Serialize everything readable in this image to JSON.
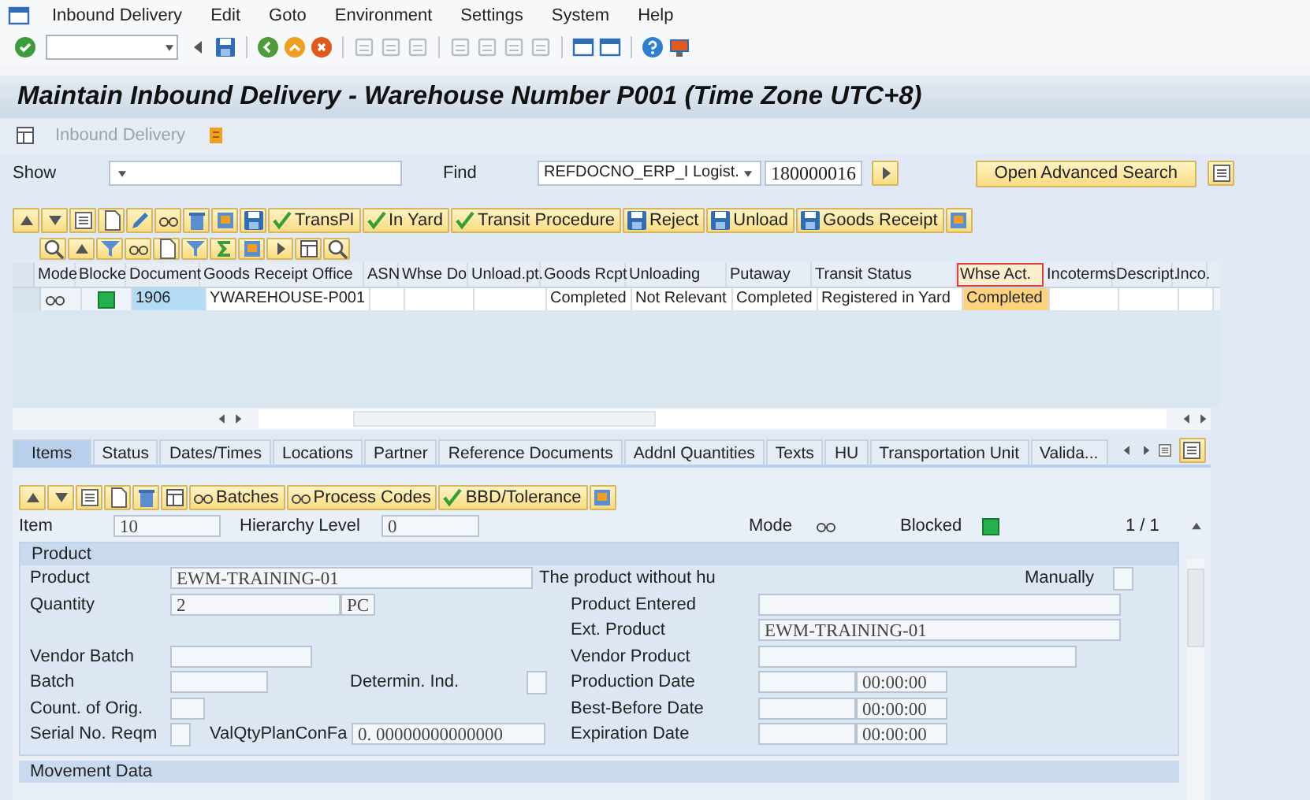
{
  "menu_bar": [
    "Inbound Delivery",
    "Edit",
    "Goto",
    "Environment",
    "Settings",
    "System",
    "Help"
  ],
  "title": "Maintain Inbound Delivery - Warehouse Number P001 (Time Zone UTC+8)",
  "app_toolbar": {
    "label": "Inbound Delivery",
    "disabled": true
  },
  "search": {
    "show_label": "Show",
    "find_label": "Find",
    "find_field": "REFDOCNO_ERP_I Logist.",
    "find_value": "180000016",
    "advanced_button": "Open Advanced Search"
  },
  "list_toolbar": [
    "TransPl",
    "In Yard",
    "Transit Procedure",
    "Reject",
    "Unload",
    "Goods Receipt"
  ],
  "table": {
    "columns": [
      {
        "label": "Mode",
        "kind": "icon",
        "selected": false
      },
      {
        "label": "Blocke",
        "kind": "status",
        "selected": false
      },
      {
        "label": "Document",
        "kind": "key",
        "selected": false
      },
      {
        "label": "Goods Receipt Office",
        "kind": "text",
        "selected": false
      },
      {
        "label": "ASN",
        "kind": "text",
        "selected": false
      },
      {
        "label": "Whse Do",
        "kind": "text",
        "selected": false
      },
      {
        "label": "Unload.pt.",
        "kind": "text",
        "selected": false
      },
      {
        "label": "Goods Rcpt",
        "kind": "text",
        "selected": false
      },
      {
        "label": "Unloading",
        "kind": "text",
        "selected": false
      },
      {
        "label": "Putaway",
        "kind": "text",
        "selected": false
      },
      {
        "label": "Transit Status",
        "kind": "text",
        "selected": false
      },
      {
        "label": "Whse Act.",
        "kind": "text",
        "selected": true
      },
      {
        "label": "Incoterms",
        "kind": "text",
        "selected": false
      },
      {
        "label": "Descript.",
        "kind": "text",
        "selected": false
      },
      {
        "label": "Inco.",
        "kind": "text",
        "selected": false
      }
    ],
    "rows": [
      {
        "cells": [
          null,
          null,
          "1906",
          "YWAREHOUSE-P001",
          null,
          null,
          null,
          "Completed",
          "Not Relevant",
          "Completed",
          "Registered in Yard",
          "Completed",
          null,
          null,
          null
        ]
      }
    ]
  },
  "tabs": [
    {
      "label": "Items",
      "selected": true
    },
    {
      "label": "Status",
      "selected": false
    },
    {
      "label": "Dates/Times",
      "selected": false
    },
    {
      "label": "Locations",
      "selected": false
    },
    {
      "label": "Partner",
      "selected": false
    },
    {
      "label": "Reference Documents",
      "selected": false
    },
    {
      "label": "Addnl Quantities",
      "selected": false
    },
    {
      "label": "Texts",
      "selected": false
    },
    {
      "label": "HU",
      "selected": false
    },
    {
      "label": "Transportation Unit",
      "selected": false
    },
    {
      "label": "Valida...",
      "selected": false
    }
  ],
  "item_toolbar": [
    "Batches",
    "Process Codes",
    "BBD/Tolerance"
  ],
  "item_header": {
    "item_label": "Item",
    "item_value": "10",
    "hierarchy_label": "Hierarchy Level",
    "hierarchy_value": "0",
    "mode_label": "Mode",
    "blocked_label": "Blocked",
    "pager": "1 / 1"
  },
  "product": {
    "title": "Product",
    "product": {
      "label": "Product",
      "value": "EWM-TRAINING-01"
    },
    "description": "The product without hu",
    "manually": {
      "label": "Manually",
      "checked": false
    },
    "quantity": {
      "label": "Quantity",
      "value": "2",
      "unit": "PC"
    },
    "product_entered": {
      "label": "Product Entered"
    },
    "ext_product": {
      "label": "Ext. Product",
      "value": "EWM-TRAINING-01"
    },
    "vendor_batch": {
      "label": "Vendor Batch"
    },
    "vendor_product": {
      "label": "Vendor Product"
    },
    "batch": {
      "label": "Batch"
    },
    "determination": {
      "label": "Determin. Ind.",
      "checked": false
    },
    "country_of_origin": {
      "label": "Count. of Orig."
    },
    "serial_required": {
      "label": "Serial No. Reqm",
      "checked": false
    },
    "valqty": {
      "label": "ValQtyPlanConFa",
      "value": "0. 00000000000000"
    },
    "dates": [
      {
        "label": "Production Date",
        "time": "00:00:00"
      },
      {
        "label": "Best-Before Date",
        "time": "00:00:00"
      },
      {
        "label": "Expiration Date",
        "time": "00:00:00"
      }
    ]
  },
  "next_section": "Movement Data"
}
